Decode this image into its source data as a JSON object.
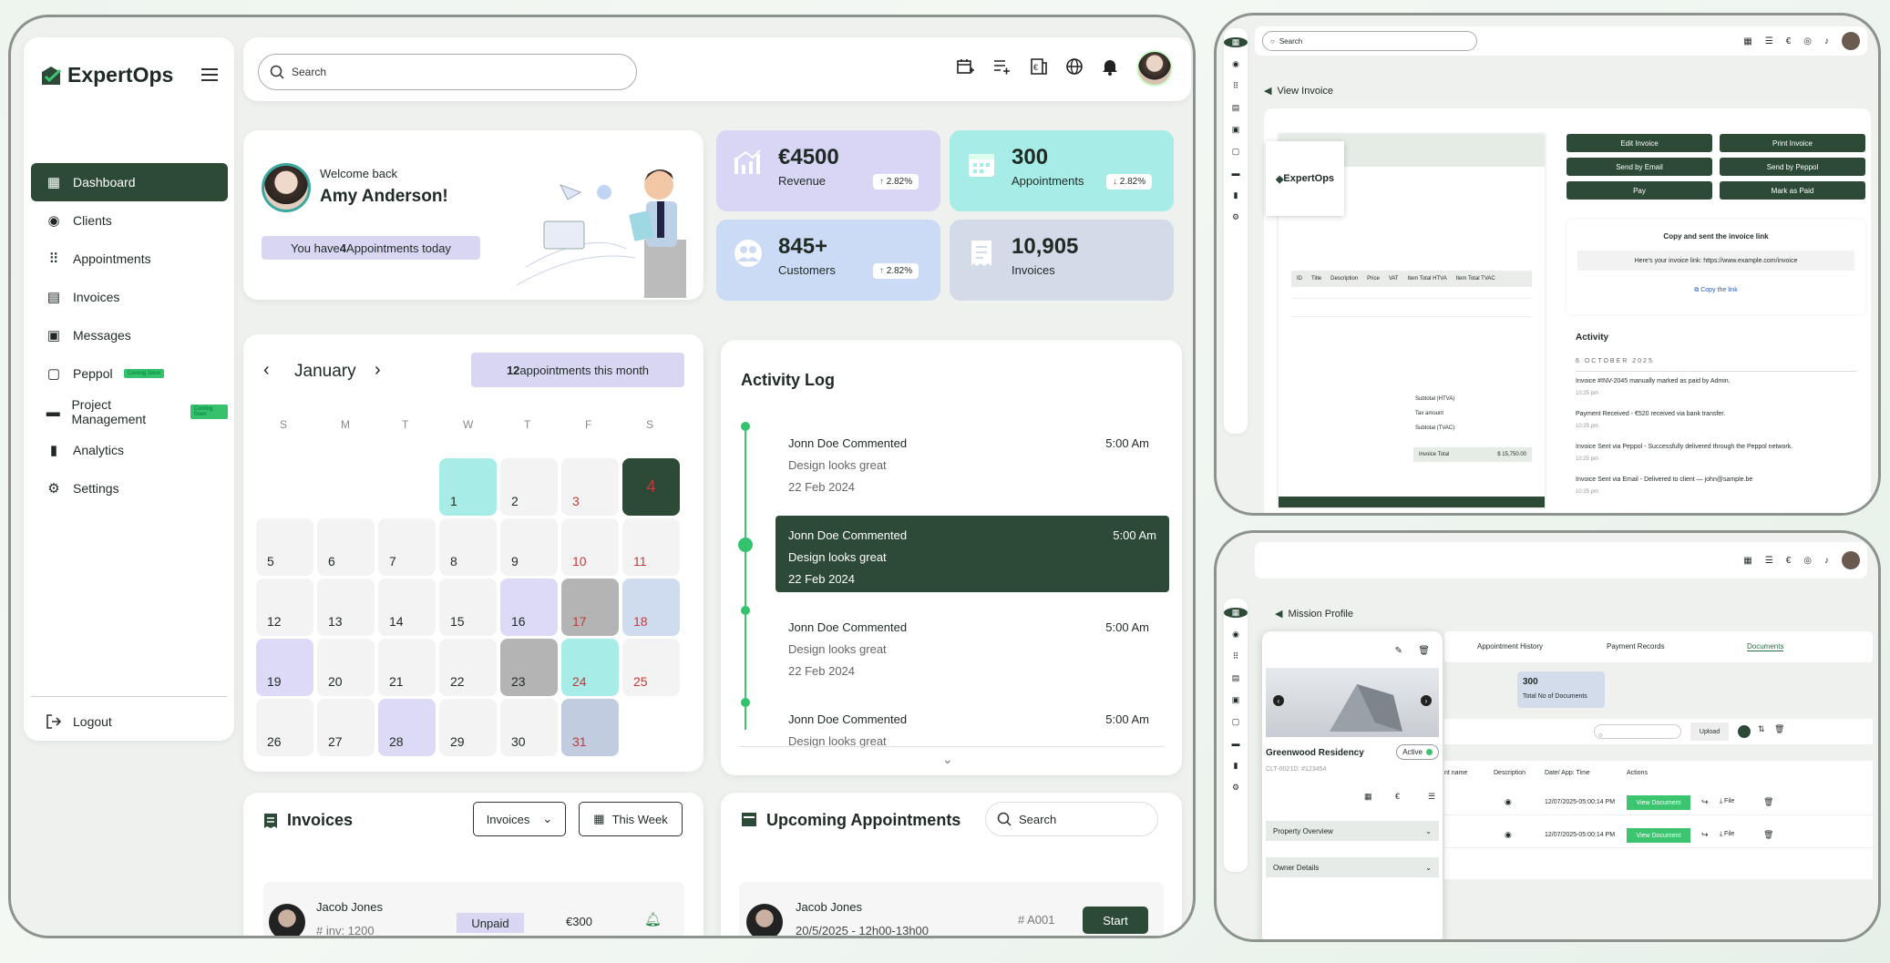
{
  "app": {
    "name": "ExpertOps"
  },
  "nav": [
    {
      "label": "Dashboard",
      "icon": "dashboard-icon"
    },
    {
      "label": "Clients",
      "icon": "user-icon"
    },
    {
      "label": "Appointments",
      "icon": "grid-icon"
    },
    {
      "label": "Invoices",
      "icon": "invoice-icon"
    },
    {
      "label": "Messages",
      "icon": "message-icon"
    },
    {
      "label": "Peppol",
      "icon": "square-icon",
      "badge": "Coming Soon"
    },
    {
      "label": "Project Management",
      "icon": "folder-icon",
      "badge": "Coming Soon"
    },
    {
      "label": "Analytics",
      "icon": "bar-chart-icon"
    },
    {
      "label": "Settings",
      "icon": "gear-icon"
    }
  ],
  "logout": "Logout",
  "search": {
    "placeholder": "Search"
  },
  "welcome": {
    "line1": "Welcome back",
    "name": "Amy Anderson!",
    "pre": "You have ",
    "count": "4",
    "post": " Appointments  today"
  },
  "stats": [
    {
      "value": "€4500",
      "label": "Revenue",
      "change": "2.82%",
      "dir": "up",
      "color": "#d8d5f5"
    },
    {
      "value": "300",
      "label": "Appointments",
      "change": "2.82%",
      "dir": "down",
      "color": "#a7ece6"
    },
    {
      "value": "845+",
      "label": "Customers",
      "change": "2.82%",
      "dir": "up",
      "color": "#cbdaf5"
    },
    {
      "value": "10,905",
      "label": "Invoices",
      "change": "",
      "dir": "",
      "color": "#d3dbe9"
    }
  ],
  "calendar": {
    "month": "January",
    "summary_count": "12",
    "summary_text": " appointments this month",
    "dow": [
      "S",
      "M",
      "T",
      "W",
      "T",
      "F",
      "S"
    ]
  },
  "activity": {
    "title": "Activity Log",
    "items": [
      {
        "title": "Jonn Doe Commented",
        "time": "5:00 Am",
        "comment": "Design looks great",
        "date": "22 Feb 2024"
      },
      {
        "title": "Jonn Doe Commented",
        "time": "5:00 Am",
        "comment": "Design looks great",
        "date": "22 Feb 2024"
      },
      {
        "title": "Jonn Doe Commented",
        "time": "5:00 Am",
        "comment": "Design looks great",
        "date": "22 Feb 2024"
      },
      {
        "title": "Jonn Doe Commented",
        "time": "5:00 Am",
        "comment": "Design looks great",
        "date": ""
      }
    ]
  },
  "invoices": {
    "title": "Invoices",
    "filter": "Invoices",
    "period": "This Week",
    "row": {
      "name": "Jacob Jones",
      "inv": "# inv: 1200",
      "status": "Unpaid",
      "amount": "€300"
    }
  },
  "upcoming": {
    "title": "Upcoming Appointments",
    "search": "Search",
    "row": {
      "name": "Jacob Jones",
      "when": "20/5/2025 - 12h00-13h00",
      "id": "# A001",
      "action": "Start"
    }
  },
  "invoice_view": {
    "back": "View Invoice",
    "search": "Search",
    "actions": [
      "Edit Invoice",
      "Print Invoice",
      "Send by Email",
      "Send by Peppol",
      "Pay",
      "Mark as Paid"
    ],
    "link_title": "Copy and sent the invoice link",
    "link_text": "Here's your invoice link: https://www.example.com/invoice",
    "copy": "Copy the link",
    "act_title": "Activity",
    "act_date": "6 OCTOBER 2025",
    "acts": [
      {
        "t": "Invoice #INV-2045 manually marked as paid by Admin.",
        "time": "10:25 pm"
      },
      {
        "t": "Payment Received - €520 received via bank transfer.",
        "time": "10:25 pm"
      },
      {
        "t": "Invoice Sent via Peppol - Successfully delivered through the Peppol network.",
        "time": "10:25 pm"
      },
      {
        "t": "Invoice Sent via Email - Delivered to client — john@sample.be",
        "time": "10:25 pm"
      }
    ],
    "doc": {
      "title": "ExpertOps",
      "subtotal": "Subtotal (HTVA)",
      "tax": "Tax amount",
      "subtotal2": "Subtotal (TVAC)",
      "total": "Invoice Total",
      "total_val": "$ 15,750.00",
      "col": [
        "ID",
        "Title",
        "Description",
        "Price",
        "VAT",
        "Item Total HTVA",
        "Item Total TVAC"
      ]
    }
  },
  "mission": {
    "back": "Mission Profile",
    "tabs": [
      "Appointment History",
      "Payment Records",
      "Documents"
    ],
    "docs_count": "300",
    "docs_label": "Total  No of Documents",
    "name": "Greenwood Residency",
    "status": "Active",
    "code": "CLT-0021D: #123454",
    "sections": [
      "Property Overview",
      "Owner Details"
    ],
    "upload": "Upload",
    "cols": [
      "nt name",
      "Description",
      "Date/ App: Time",
      "Actions"
    ],
    "rows": [
      {
        "date": "12/07/2025-05:00:14 PM",
        "btn": "View Document",
        "file": "File"
      },
      {
        "date": "12/07/2025-05:00:14 PM",
        "btn": "View Document",
        "file": "File"
      }
    ]
  }
}
